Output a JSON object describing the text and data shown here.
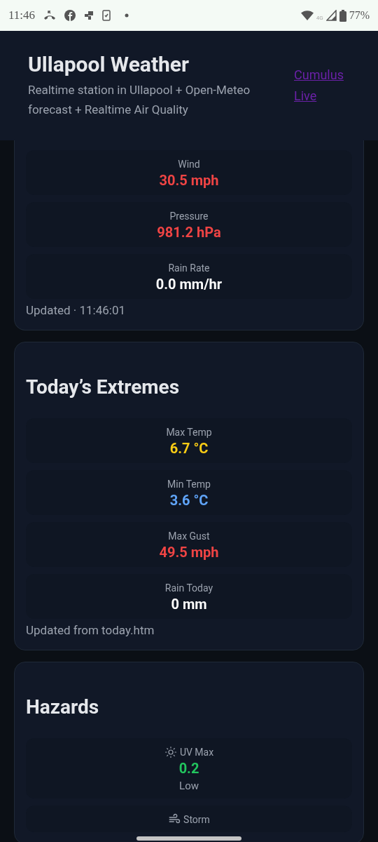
{
  "status_bar": {
    "time": "11:46",
    "network": "4G",
    "battery": "77%"
  },
  "header": {
    "title": "Ullapool Weather",
    "subtitle": "Realtime station in Ullapool + Open-Meteo forecast + Realtime Air Quality",
    "link_lines": [
      "Cumulus",
      "Live"
    ]
  },
  "cards": [
    {
      "cut_top": true,
      "metrics": [
        {
          "label": "Wind",
          "value": "30.5 mph",
          "color": "#ef4444"
        },
        {
          "label": "Pressure",
          "value": "981.2 hPa",
          "color": "#ef4444"
        },
        {
          "label": "Rain Rate",
          "value": "0.0 mm/hr",
          "color": "#ffffff"
        }
      ],
      "footer": "Updated · 11:46:01"
    },
    {
      "title": "Today’s Extremes",
      "cut_top": false,
      "metrics": [
        {
          "label": "Max Temp",
          "value": "6.7 °C",
          "color": "#facc15"
        },
        {
          "label": "Min Temp",
          "value": "3.6 °C",
          "color": "#60a5fa"
        },
        {
          "label": "Max Gust",
          "value": "49.5 mph",
          "color": "#ef4444"
        },
        {
          "label": "Rain Today",
          "value": "0 mm",
          "color": "#ffffff"
        }
      ],
      "footer": "Updated from today.htm"
    },
    {
      "title": "Hazards",
      "cut_top": false,
      "metrics": [
        {
          "label": "UV Max",
          "kind": "uv",
          "value": "0.2",
          "color": "#22c55e",
          "note": "Low"
        },
        {
          "label": "Storm",
          "kind": "storm"
        }
      ]
    }
  ]
}
